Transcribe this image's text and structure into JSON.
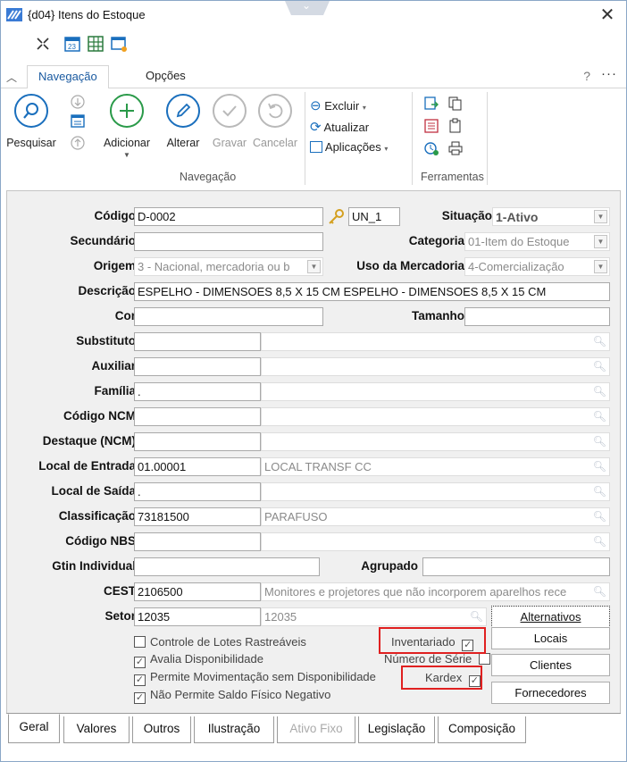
{
  "window": {
    "title": "{d04} Itens do Estoque"
  },
  "ribbon": {
    "tabs": [
      "Navegação",
      "Opções"
    ],
    "help": "?",
    "more": "···",
    "groups": {
      "navegacao": "Navegação",
      "ferramentas": "Ferramentas"
    },
    "buttons": {
      "pesquisar": "Pesquisar",
      "adicionar": "Adicionar",
      "alterar": "Alterar",
      "gravar": "Gravar",
      "cancelar": "Cancelar"
    },
    "menu": {
      "excluir": "Excluir",
      "atualizar": "Atualizar",
      "aplicacoes": "Aplicações"
    }
  },
  "form": {
    "labels": {
      "codigo": "Código",
      "situacao": "Situação",
      "secundario": "Secundário",
      "categoria": "Categoria",
      "origem": "Origem",
      "uso": "Uso da Mercadoria",
      "descricao": "Descrição",
      "cor": "Cor",
      "tamanho": "Tamanho",
      "substituto": "Substituto",
      "auxiliar": "Auxiliar",
      "familia": "Família",
      "ncm": "Código NCM",
      "destaque": "Destaque (NCM)",
      "local_entrada": "Local de Entrada",
      "local_saida": "Local de Saída",
      "classificacao": "Classificação",
      "nbs": "Código NBS",
      "gtin": "Gtin Individual",
      "agrupado": "Agrupado",
      "cest": "CEST",
      "setor": "Setor"
    },
    "values": {
      "codigo": "D-0002",
      "unidade": "UN_1",
      "situacao": "1-Ativo",
      "categoria": "01-Item do Estoque",
      "origem": "3 - Nacional, mercadoria ou b",
      "uso": "4-Comercialização",
      "descricao": "ESPELHO - DIMENSOES 8,5 X 15 CM ESPELHO - DIMENSOES 8,5 X 15 CM",
      "familia": ".",
      "local_entrada_code": "01.00001",
      "local_entrada_desc": "LOCAL TRANSF CC",
      "local_saida_code": ".",
      "classificacao_code": "73181500",
      "classificacao_desc": "PARAFUSO",
      "cest_code": "2106500",
      "cest_desc": "Monitores e projetores que não incorporem aparelhos rece",
      "setor_code": "12035",
      "setor_desc": "12035"
    },
    "buttons": {
      "alternativos": "Alternativos",
      "locais": "Locais",
      "clientes": "Clientes",
      "fornecedores": "Fornecedores"
    },
    "checks": {
      "lotes": "Controle de Lotes Rastreáveis",
      "avalia": "Avalia Disponibilidade",
      "permite": "Permite Movimentação sem Disponibilidade",
      "nao_permite": "Não Permite Saldo Físico Negativo",
      "inventariado": "Inventariado",
      "numero_serie": "Número de Série",
      "kardex": "Kardex"
    }
  },
  "bottom_tabs": [
    "Geral",
    "Valores",
    "Outros",
    "Ilustração",
    "Ativo Fixo",
    "Legislação",
    "Composição"
  ],
  "colors": {
    "accent": "#1a6fbd",
    "highlight": "#e02020"
  }
}
